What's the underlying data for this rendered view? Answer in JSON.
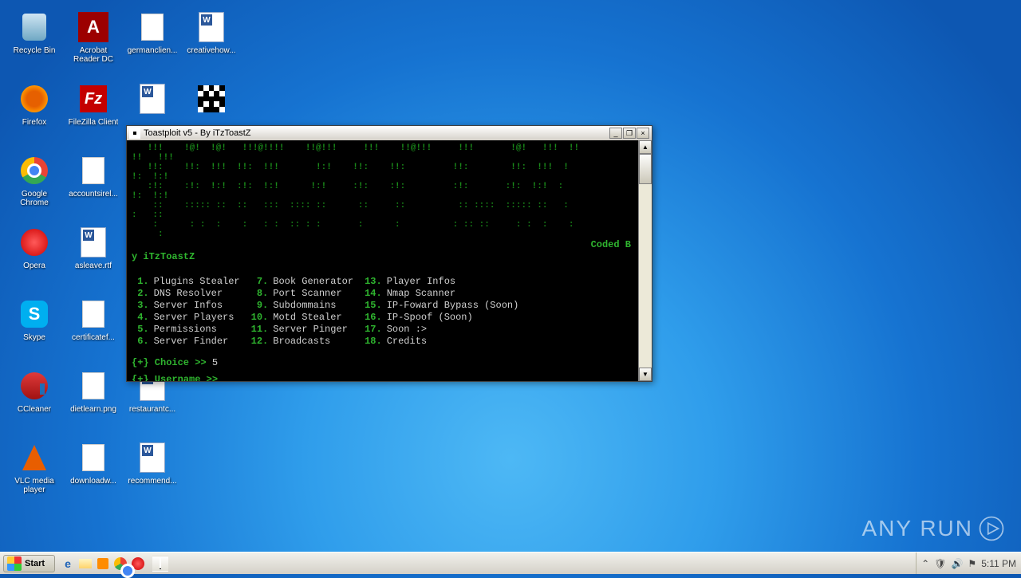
{
  "desktop_icons": {
    "recycle": "Recycle Bin",
    "adobe": "Acrobat Reader DC",
    "germanclien": "germanclien...",
    "creativehow": "creativehow...",
    "firefox": "Firefox",
    "filezilla": "FileZilla Client",
    "word1": "",
    "invader": "",
    "chrome": "Google Chrome",
    "accounts": "accountsirel...",
    "opera": "Opera",
    "asleave": "asleave.rtf",
    "skype": "Skype",
    "certificate": "certificatef...",
    "ccleaner": "CCleaner",
    "dietlearn": "dietlearn.png",
    "restaurant": "restaurantc...",
    "vlc": "VLC media player",
    "downloadw": "downloadw...",
    "recommend": "recommend..."
  },
  "window": {
    "title": "Toastploit v5 - By iTzToastZ",
    "min_tip": "Minimize",
    "max_tip": "Restore",
    "close_tip": "Close"
  },
  "console": {
    "ascii": [
      "   !!!    !@!  !@!   !!!@!!!!    !!@!!!     !!!    !!@!!!     !!!       !@!   !!!  !!",
      "!!   !!!",
      "   !!:    !!:  !!!  !!:  !!!       !:!    !!:    !!:         !!:        !!:  !!!  !",
      "!:  !:!",
      "   :!:    :!:  !:!  :!:  !:!      !:!     :!:    :!:         :!:       :!:  !:!  :",
      "!:  !:!",
      "    ::    ::::: ::  ::   :::  :::: ::      ::     ::          :: ::::  ::::: ::   :",
      ":   ::",
      "    :      : :  :    :   : :  :: : :       :      :          : :: ::     : :  :    :",
      "     :"
    ],
    "coded_by": "Coded B",
    "y_tail": "y iTzToastZ",
    "menu": [
      {
        "n": "1.",
        "t": "Plugins Stealer"
      },
      {
        "n": "2.",
        "t": "DNS Resolver"
      },
      {
        "n": "3.",
        "t": "Server Infos"
      },
      {
        "n": "4.",
        "t": "Server Players"
      },
      {
        "n": "5.",
        "t": "Permissions"
      },
      {
        "n": "6.",
        "t": "Server Finder"
      },
      {
        "n": "7.",
        "t": "Book Generator"
      },
      {
        "n": "8.",
        "t": "Port Scanner"
      },
      {
        "n": "9.",
        "t": "Subdommains"
      },
      {
        "n": "10.",
        "t": "Motd Stealer"
      },
      {
        "n": "11.",
        "t": "Server Pinger"
      },
      {
        "n": "12.",
        "t": "Broadcasts"
      },
      {
        "n": "13.",
        "t": "Player Infos"
      },
      {
        "n": "14.",
        "t": "Nmap Scanner"
      },
      {
        "n": "15.",
        "t": "IP-Foward Bypass (Soon)"
      },
      {
        "n": "16.",
        "t": "IP-Spoof (Soon)"
      },
      {
        "n": "17.",
        "t": "Soon :>"
      },
      {
        "n": "18.",
        "t": "Credits"
      }
    ],
    "choice_prompt": "{+} Choice >> ",
    "choice_value": "5",
    "user_prompt": "{+} Username >> "
  },
  "taskbar": {
    "start": "Start",
    "clock": "5:11 PM"
  },
  "watermark": "ANY    RUN"
}
